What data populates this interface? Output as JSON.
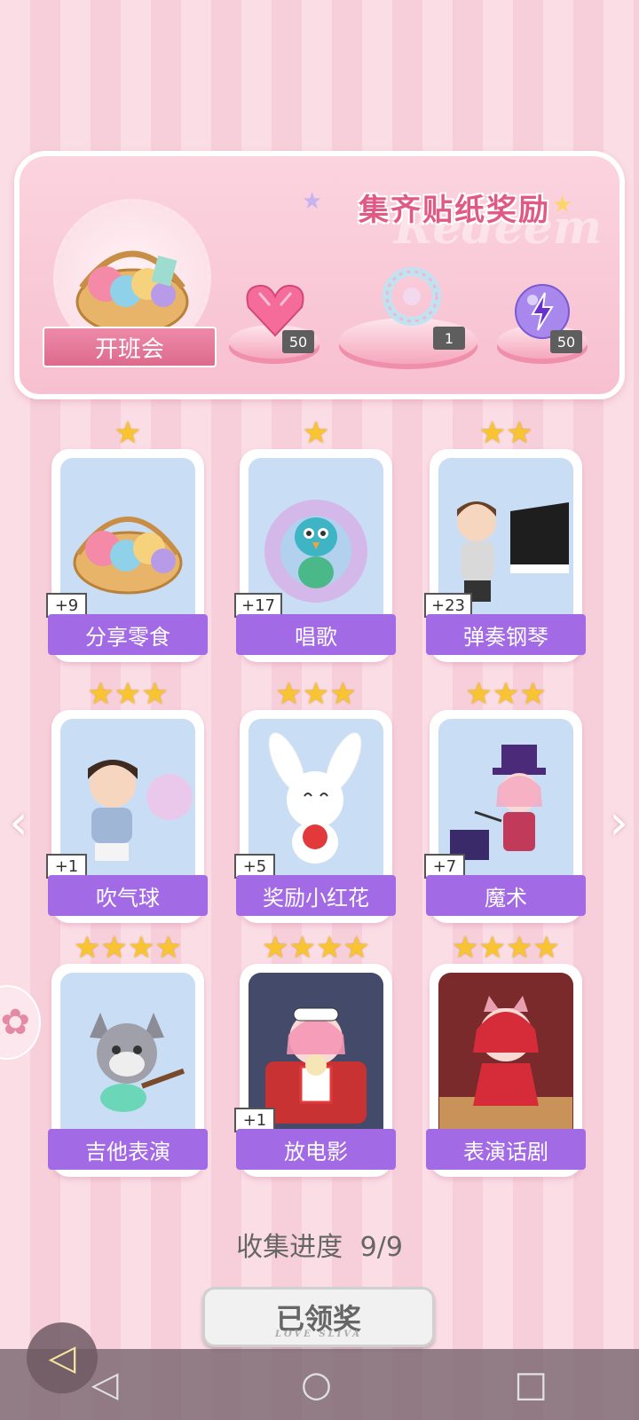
{
  "banner": {
    "title": "集齐贴纸奖励",
    "watermark": "Redeem",
    "ribbon_label": "开班会",
    "rewards": [
      {
        "icon": "heart-gem-icon",
        "count": "50"
      },
      {
        "icon": "crystal-ring-icon",
        "count": "1"
      },
      {
        "icon": "lightning-orb-icon",
        "count": "50"
      }
    ]
  },
  "stickers": [
    {
      "label": "分享零食",
      "count": "+9",
      "stars": "★",
      "icon": "snack-basket-icon"
    },
    {
      "label": "唱歌",
      "count": "+17",
      "stars": "★",
      "icon": "peacock-singer-icon"
    },
    {
      "label": "弹奏钢琴",
      "count": "+23",
      "stars": "★★",
      "icon": "piano-boy-icon"
    },
    {
      "label": "吹气球",
      "count": "+1",
      "stars": "★★★",
      "icon": "bubble-boy-icon"
    },
    {
      "label": "奖励小红花",
      "count": "+5",
      "stars": "★★★",
      "icon": "bunny-flower-icon"
    },
    {
      "label": "魔术",
      "count": "+7",
      "stars": "★★★",
      "icon": "magician-girl-icon"
    },
    {
      "label": "吉他表演",
      "count": "",
      "stars": "★★★★",
      "icon": "wolf-guitar-icon"
    },
    {
      "label": "放电影",
      "count": "+1",
      "stars": "★★★★",
      "icon": "movie-girl-icon"
    },
    {
      "label": "表演话剧",
      "count": "",
      "stars": "★★★★",
      "icon": "theater-cat-icon"
    }
  ],
  "progress": {
    "label": "收集进度",
    "value": "9/9"
  },
  "claim_button": {
    "label": "已领奖",
    "sub": "LOVE SLIVA"
  },
  "nav": {
    "left_arrow": "‹",
    "right_arrow": "›",
    "back": "◁",
    "home": "○",
    "recents": "□",
    "float_back": "◁"
  }
}
